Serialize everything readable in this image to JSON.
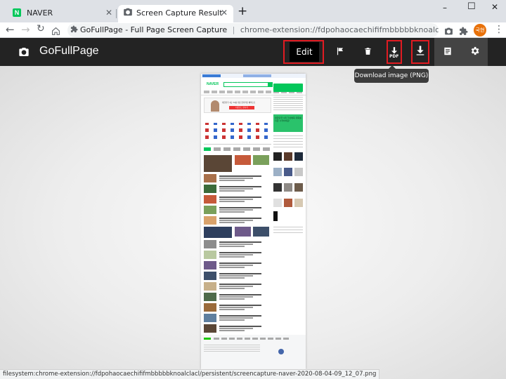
{
  "browser": {
    "tabs": [
      {
        "title": "NAVER",
        "favicon": "naver-icon",
        "active": false
      },
      {
        "title": "Screen Capture Result",
        "favicon": "camera-icon",
        "active": true
      }
    ],
    "new_tab": "+",
    "window_controls": {
      "minimize": "–",
      "maximize": "☐",
      "close": "✕"
    },
    "address": {
      "page_title": "GoFullPage - Full Page Screen Capture",
      "separator": "|",
      "url": "chrome-extension://fdpohaocaechififmbbbbbknoalclacl/capture.html..."
    },
    "profile_label": "국현"
  },
  "app": {
    "name": "GoFullPage",
    "edit_label": "Edit",
    "pdf_label": "PDF",
    "tooltip": "Download image (PNG)",
    "accent": "#e11b22"
  },
  "preview": {
    "logo": "NAVER",
    "ad_line1": "대한민국 1등 TV를 가장 합리적인 혜택으로",
    "ad_line2": "다운로드 만나기",
    "promo": "대한민국 1위 가상예측 대회를 지금 시작하세요!",
    "brand_color": "#03c75a"
  },
  "status_bar": "filesystem:chrome-extension://fdpohaocaechififmbbbbbknoalclacl/persistent/screencapture-naver-2020-08-04-09_12_07.png"
}
